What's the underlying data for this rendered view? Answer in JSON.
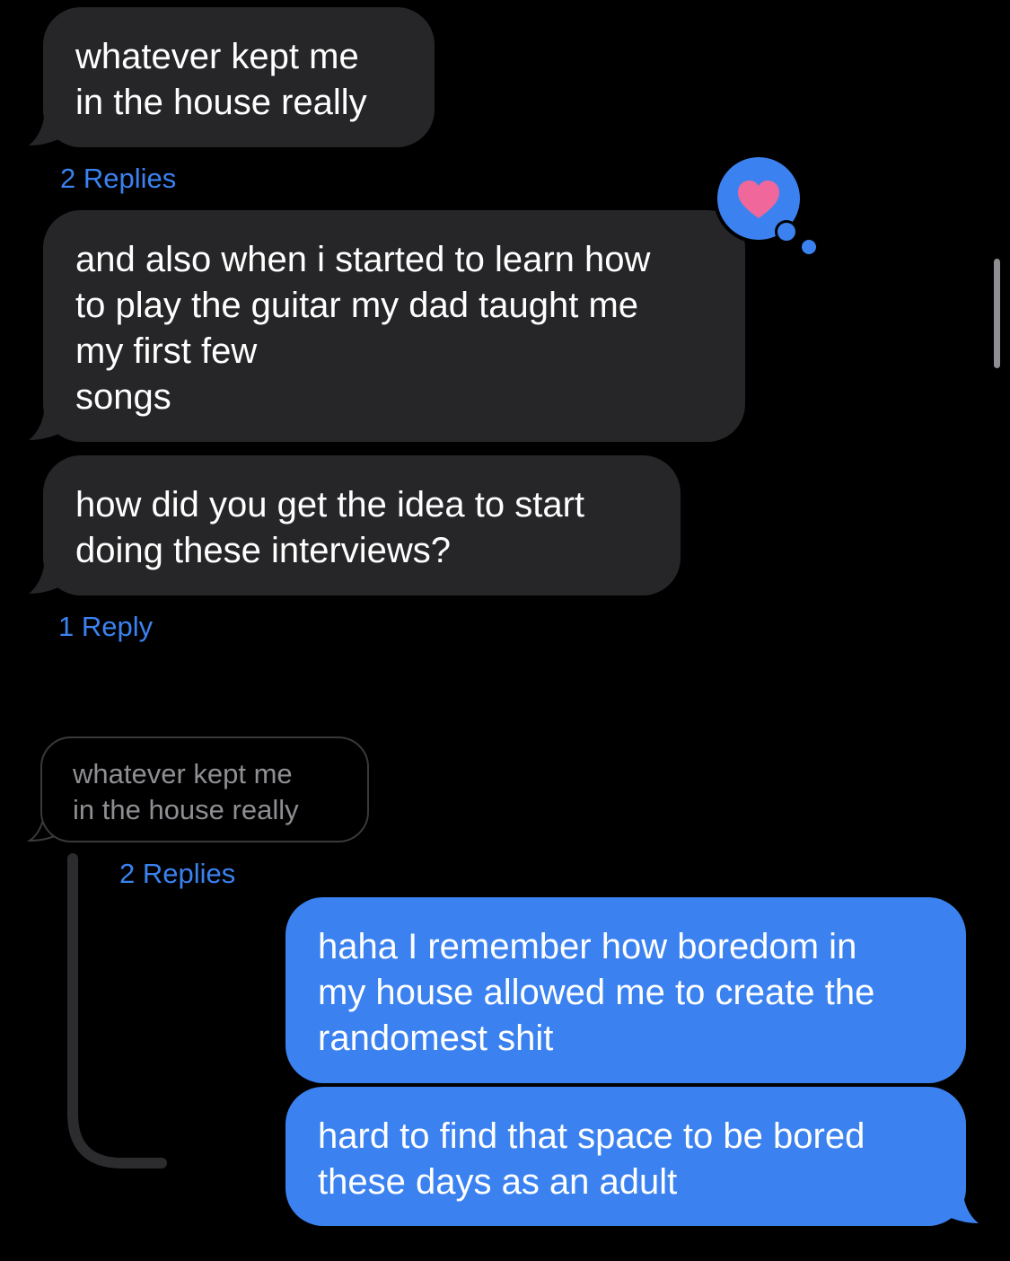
{
  "colors": {
    "background": "#000000",
    "received_bubble": "#262628",
    "sent_bubble": "#3b82f0",
    "reply_link": "#3b82f0",
    "quoted_text": "#8e8e93",
    "heart": "#f0679b"
  },
  "messages": [
    {
      "direction": "received",
      "lines": [
        "whatever kept me",
        "in the house really"
      ],
      "reply_link": "2 Replies"
    },
    {
      "direction": "received",
      "lines": [
        "and also when i started to learn how",
        "to play the guitar my dad taught me",
        "my first few",
        "songs"
      ],
      "tapback": "heart-icon"
    },
    {
      "direction": "received",
      "lines": [
        "how did you get the idea to start",
        "doing these interviews?"
      ],
      "reply_link": "1 Reply"
    }
  ],
  "thread": {
    "quoted": {
      "lines": [
        "whatever kept me",
        "in the house really"
      ]
    },
    "reply_link": "2 Replies",
    "replies": [
      {
        "direction": "sent",
        "lines": [
          "haha I remember how boredom in",
          "my house allowed me to create the",
          "randomest shit"
        ]
      },
      {
        "direction": "sent",
        "lines": [
          "hard to find that space to be bored",
          "these days as an adult"
        ]
      }
    ]
  }
}
